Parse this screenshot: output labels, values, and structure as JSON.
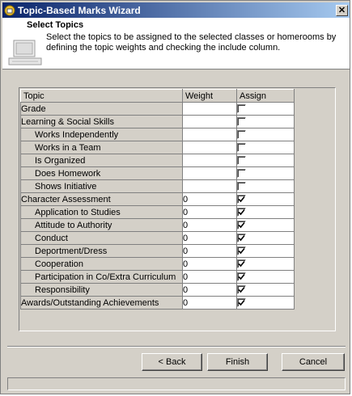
{
  "window": {
    "title": "Topic-Based Marks Wizard",
    "close_glyph": "✕"
  },
  "header": {
    "heading": "Select Topics",
    "description": "Select the topics to be assigned to the selected classes or homerooms by defining the topic weights and checking the include column."
  },
  "grid": {
    "columns": {
      "topic": "Topic",
      "weight": "Weight",
      "assign": "Assign"
    },
    "rows": [
      {
        "topic": "Grade",
        "weight": "",
        "assigned": false,
        "child": false
      },
      {
        "topic": "Learning & Social Skills",
        "weight": "",
        "assigned": false,
        "child": false
      },
      {
        "topic": "Works Independently",
        "weight": "",
        "assigned": false,
        "child": true
      },
      {
        "topic": "Works in a Team",
        "weight": "",
        "assigned": false,
        "child": true
      },
      {
        "topic": "Is Organized",
        "weight": "",
        "assigned": false,
        "child": true
      },
      {
        "topic": "Does Homework",
        "weight": "",
        "assigned": false,
        "child": true
      },
      {
        "topic": "Shows Initiative",
        "weight": "",
        "assigned": false,
        "child": true
      },
      {
        "topic": "Character Assessment",
        "weight": "0",
        "assigned": true,
        "child": false
      },
      {
        "topic": "Application to Studies",
        "weight": "0",
        "assigned": true,
        "child": true
      },
      {
        "topic": "Attitude to Authority",
        "weight": "0",
        "assigned": true,
        "child": true
      },
      {
        "topic": "Conduct",
        "weight": "0",
        "assigned": true,
        "child": true
      },
      {
        "topic": "Deportment/Dress",
        "weight": "0",
        "assigned": true,
        "child": true
      },
      {
        "topic": "Cooperation",
        "weight": "0",
        "assigned": true,
        "child": true
      },
      {
        "topic": "Participation in Co/Extra Curriculum",
        "weight": "0",
        "assigned": true,
        "child": true
      },
      {
        "topic": "Responsibility",
        "weight": "0",
        "assigned": true,
        "child": true
      },
      {
        "topic": "Awards/Outstanding Achievements",
        "weight": "0",
        "assigned": true,
        "child": false
      }
    ]
  },
  "buttons": {
    "back": "< Back",
    "finish": "Finish",
    "cancel": "Cancel"
  },
  "status": {
    "text": ""
  },
  "icons": {
    "title": "wizard-app-icon",
    "close": "close-icon",
    "header_art": "computer-illustration-icon",
    "check": "checkmark-icon"
  },
  "colors": {
    "title_start": "#0a246a",
    "title_end": "#a6caf0",
    "face": "#d4d0c8"
  }
}
